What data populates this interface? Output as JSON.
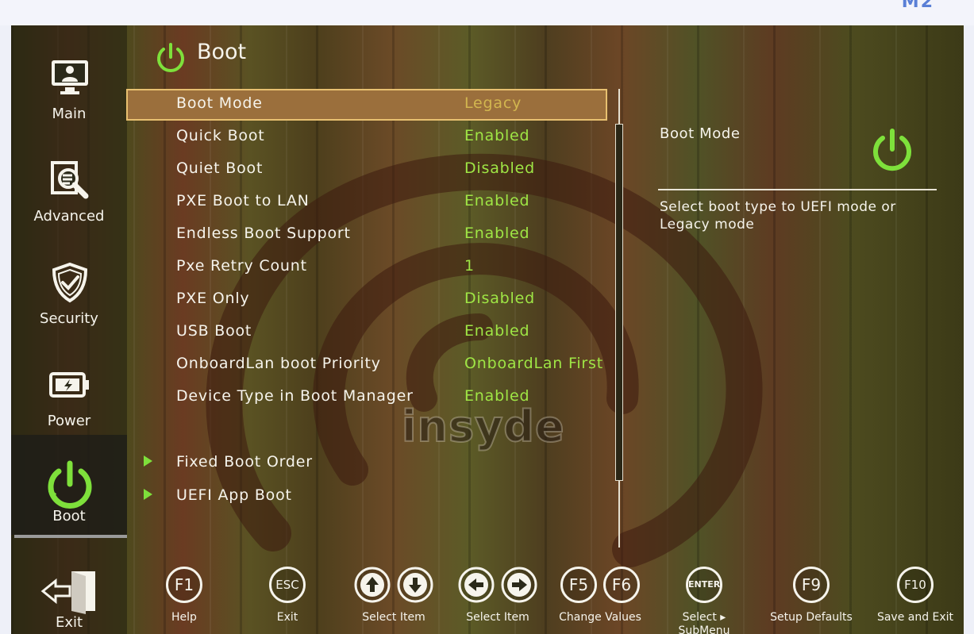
{
  "app": {
    "page_title": "Boot"
  },
  "sidebar": {
    "items": [
      {
        "label": "Main",
        "icon": "monitor-user-icon",
        "active": false
      },
      {
        "label": "Advanced",
        "icon": "magnifier-document-icon",
        "active": false
      },
      {
        "label": "Security",
        "icon": "shield-check-icon",
        "active": false
      },
      {
        "label": "Power",
        "icon": "battery-icon",
        "active": false
      },
      {
        "label": "Boot",
        "icon": "power-icon",
        "active": true
      }
    ],
    "exit_label": "Exit",
    "exit_icon": "exit-door-icon"
  },
  "menu": {
    "rows": [
      {
        "label": "Boot Mode",
        "value": "Legacy",
        "selected": true
      },
      {
        "label": "Quick Boot",
        "value": "Enabled"
      },
      {
        "label": "Quiet Boot",
        "value": "Disabled"
      },
      {
        "label": "PXE Boot to LAN",
        "value": "Enabled"
      },
      {
        "label": "Endless Boot Support",
        "value": "Enabled"
      },
      {
        "label": "Pxe Retry Count",
        "value": "1"
      },
      {
        "label": "PXE Only",
        "value": "Disabled"
      },
      {
        "label": "USB Boot",
        "value": "Enabled"
      },
      {
        "label": "OnboardLan boot Priority",
        "value": "OnboardLan First"
      },
      {
        "label": "Device Type in Boot Manager",
        "value": "Enabled"
      }
    ],
    "submenus": [
      {
        "label": "Fixed Boot Order"
      },
      {
        "label": "UEFI App Boot"
      }
    ]
  },
  "help": {
    "title": "Boot Mode",
    "text": "Select boot type to UEFI mode or Legacy mode"
  },
  "watermark": "insyde",
  "header_logo_fragment": "M2",
  "keys": [
    {
      "key": "F1",
      "label": "Help"
    },
    {
      "key": "ESC",
      "label": "Exit"
    },
    {
      "key": "↑↓",
      "label": "Select Item"
    },
    {
      "key": "←→",
      "label": "Select Item"
    },
    {
      "key": "F5F6",
      "label": "Change Values"
    },
    {
      "key": "ENTER",
      "label": "Select ▸ SubMenu"
    },
    {
      "key": "F9",
      "label": "Setup Defaults"
    },
    {
      "key": "F10",
      "label": "Save and Exit"
    }
  ],
  "colors": {
    "value_green": "#9fe645",
    "selected_value": "#d2b64f",
    "selection_bg": "#9b6f3c",
    "selection_border": "#e8c070",
    "accent_green": "#7ee03b",
    "text": "#f6f4ec"
  }
}
